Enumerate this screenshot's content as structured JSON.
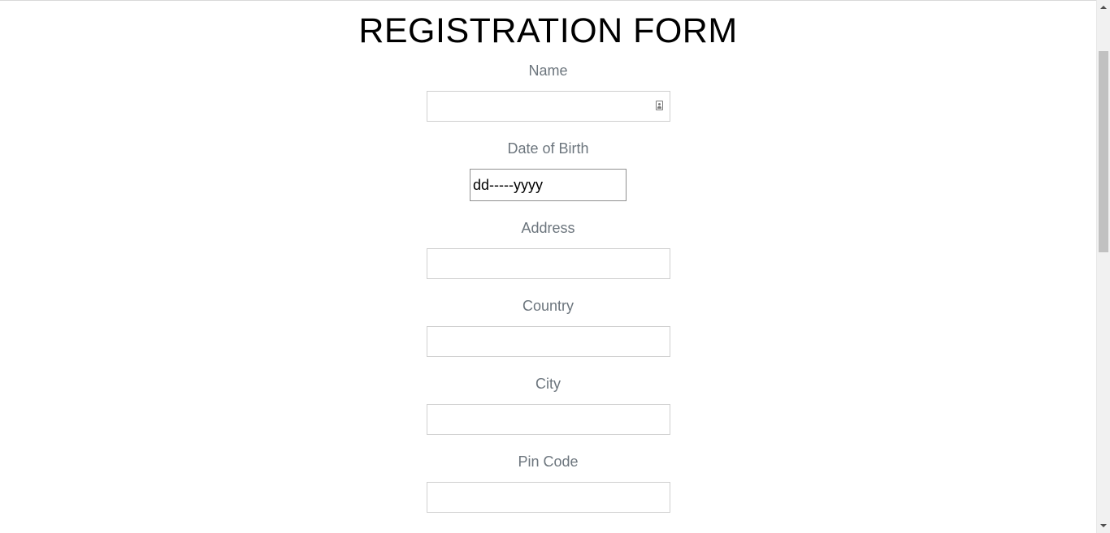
{
  "form": {
    "title": "REGISTRATION FORM",
    "fields": {
      "name": {
        "label": "Name",
        "value": "",
        "placeholder": ""
      },
      "dob": {
        "label": "Date of Birth",
        "display": "dd-----yyyy"
      },
      "address": {
        "label": "Address",
        "value": "",
        "placeholder": ""
      },
      "country": {
        "label": "Country",
        "value": "",
        "placeholder": ""
      },
      "city": {
        "label": "City",
        "value": "",
        "placeholder": ""
      },
      "pincode": {
        "label": "Pin Code",
        "value": "",
        "placeholder": ""
      }
    }
  },
  "icons": {
    "name_autofill": "contact-card-icon",
    "scroll_up": "scroll-up-arrow-icon",
    "scroll_down": "scroll-down-arrow-icon"
  },
  "colors": {
    "label": "#6c757d",
    "title": "#000000",
    "field_border": "#cfcfcf",
    "scroll_thumb": "#c1c1c1"
  }
}
